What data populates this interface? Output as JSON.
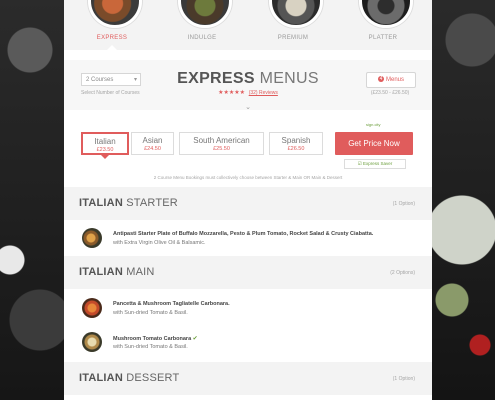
{
  "categories": [
    {
      "label": "EXPRESS",
      "active": true
    },
    {
      "label": "INDULGE",
      "active": false
    },
    {
      "label": "PREMIUM",
      "active": false
    },
    {
      "label": "PLATTER",
      "active": false
    }
  ],
  "header": {
    "courses_select": "2 Courses",
    "courses_sub": "Select Number of Courses",
    "title_bold": "EXPRESS",
    "title_rest": " MENUS",
    "stars": "★★★★★",
    "reviews": "(32) Reviews",
    "menus_button": "Menus",
    "menus_badge": "4",
    "price_range": "(£23.50 - £26.50)"
  },
  "cuisines": [
    {
      "name": "Italian",
      "price": "£23.50",
      "selected": true
    },
    {
      "name": "Asian",
      "price": "£24.50",
      "selected": false
    },
    {
      "name": "South American",
      "price": "£25.50",
      "selected": false
    },
    {
      "name": "Spanish",
      "price": "£26.50",
      "selected": false
    }
  ],
  "logo_tag": "sign.city",
  "get_price_label": "Get Price Now",
  "express_saver": "Express Saver",
  "course_note": "2 Course Menu Bookings must collectively choose between Starter & Main OR Main & Dessert",
  "sections": {
    "starter": {
      "title_bold": "ITALIAN",
      "title_rest": " STARTER",
      "options": "(1 Option)",
      "items": [
        {
          "line1": "Antipasti Starter Plate of Buffalo Mozzarella, Pesto & Plum Tomato, Rocket Salad & Crusty Ciabatta.",
          "line2": "with Extra Virgin Olive Oil & Balsamic."
        }
      ]
    },
    "main": {
      "title_bold": "ITALIAN",
      "title_rest": " MAIN",
      "options": "(2 Options)",
      "items": [
        {
          "line1": "Pancetta & Mushroom Tagliatelle Carbonara.",
          "line2": "with Sun-dried Tomato & Basil."
        },
        {
          "line1": "Mushroom Tomato Carbonara",
          "veg": "✔",
          "line2": "with Sun-dried Tomato & Basil."
        }
      ]
    },
    "dessert": {
      "title_bold": "ITALIAN",
      "title_rest": " DESSERT",
      "options": "(1 Option)"
    }
  },
  "colors": {
    "accent": "#e05c5c",
    "veg": "#6b9e3c"
  }
}
